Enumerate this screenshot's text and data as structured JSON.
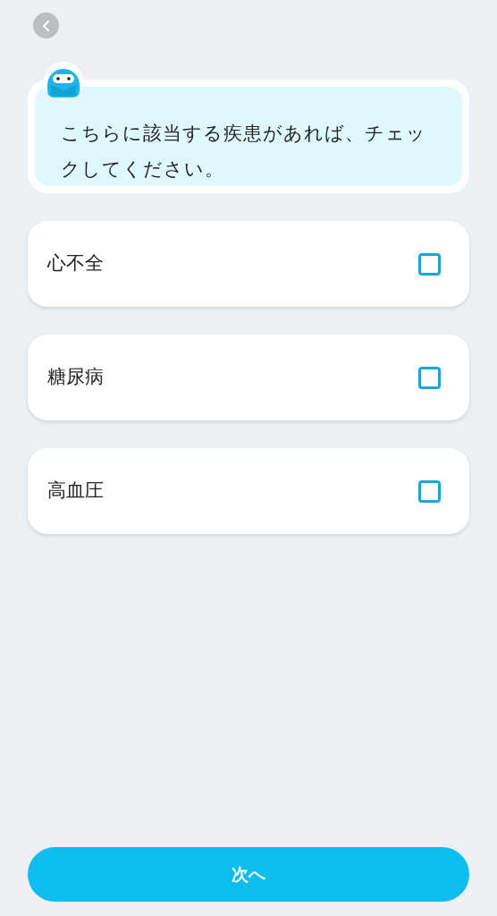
{
  "message": "こちらに該当する疾患があれば、チェックしてください。",
  "conditions": [
    {
      "label": "心不全",
      "checked": false
    },
    {
      "label": "糖尿病",
      "checked": false
    },
    {
      "label": "高血圧",
      "checked": false
    }
  ],
  "next_button": "次へ"
}
